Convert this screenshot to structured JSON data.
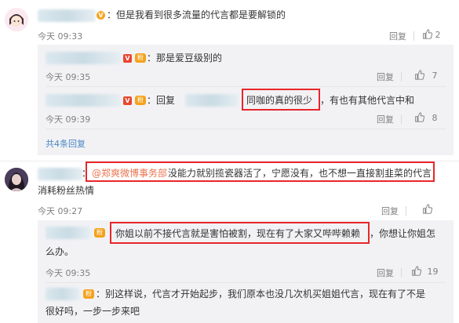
{
  "comments": [
    {
      "text": "：但是我看到很多流量的代言都是要解锁的",
      "time": "今天 09:33",
      "reply": "回复",
      "likes": "2",
      "replies": [
        {
          "text": "：那是爱豆级别的",
          "time": "今天 09:35",
          "reply": "回复",
          "likes": "7"
        },
        {
          "prefix": "：回复",
          "highlight": "同咖的真的很少",
          "suffix": "，有也有其他代言中和",
          "time": "今天 09:39",
          "reply": "回复",
          "likes": "8"
        }
      ],
      "more": "共4条回复"
    },
    {
      "colon": "：",
      "mention": "@郑爽微博事务部",
      "text_line1": "没能力就别揽瓷器活了，宁愿没有，也不想一直接割韭菜的代言，",
      "text_line2": "消耗粉丝热情",
      "time": "今天 09:27",
      "reply": "回复",
      "replies": [
        {
          "highlight": "你姐以前不接代言就是害怕被割，现在有了大家又哔哔赖赖",
          "suffix": "，你想让你姐怎",
          "line2": "么办。",
          "time": "今天 09:35",
          "reply": "回复",
          "likes": "19"
        },
        {
          "line1": "：别这样说，代言才开始起步，我们原本也没几次机买姐姐代言，现在有了不是",
          "line2": "很好吗，一步一步来吧"
        }
      ]
    }
  ],
  "colors": {
    "highlight": "#e8262b",
    "link": "#eb7350",
    "panel": "#f2f2f5"
  }
}
